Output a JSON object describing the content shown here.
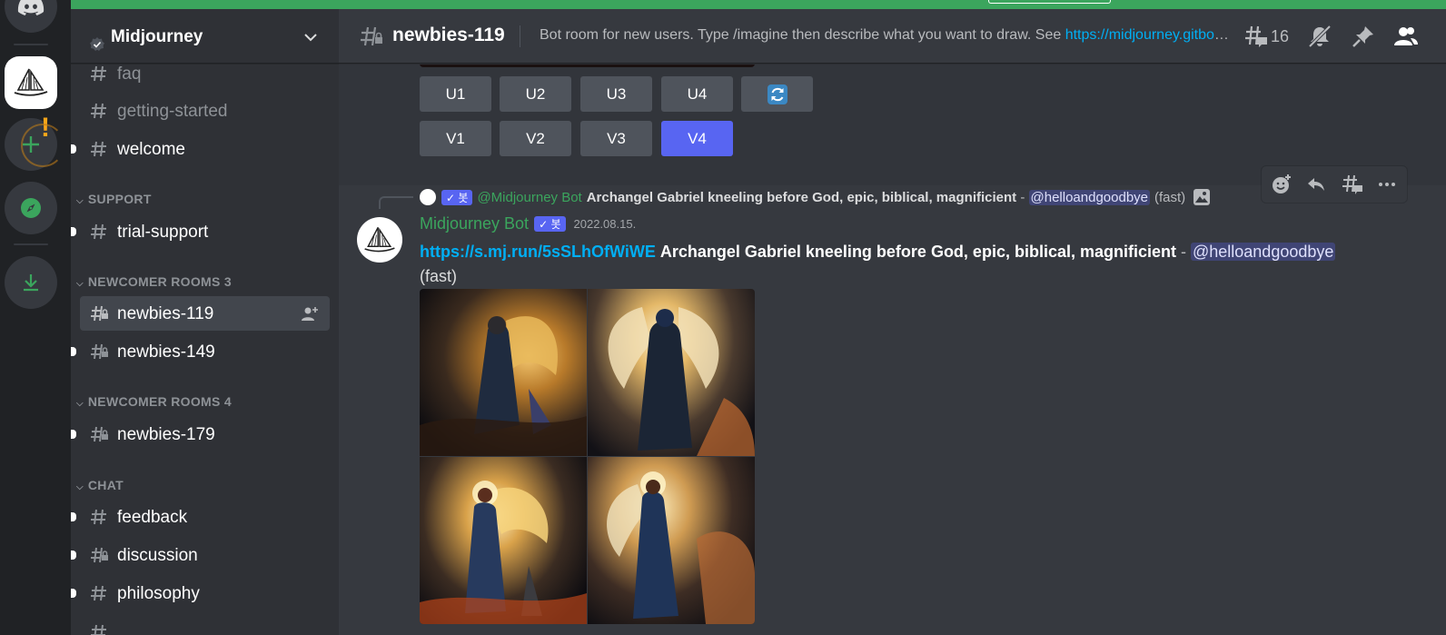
{
  "server": {
    "name": "Midjourney"
  },
  "sidebar": {
    "channels_top": [
      {
        "label": "faq"
      },
      {
        "label": "getting-started"
      },
      {
        "label": "welcome"
      }
    ],
    "categories": {
      "support": "SUPPORT",
      "newcomer3": "NEWCOMER ROOMS 3",
      "newcomer4": "NEWCOMER ROOMS 4",
      "chat": "CHAT"
    },
    "support_channels": [
      {
        "label": "trial-support"
      }
    ],
    "newcomer3_channels": [
      {
        "label": "newbies-119"
      },
      {
        "label": "newbies-149"
      }
    ],
    "newcomer4_channels": [
      {
        "label": "newbies-179"
      }
    ],
    "chat_channels": [
      {
        "label": "feedback"
      },
      {
        "label": "discussion"
      },
      {
        "label": "philosophy"
      }
    ]
  },
  "header": {
    "channel": "newbies-119",
    "topic_text": "Bot room for new users. Type /imagine then describe what you want to draw. See ",
    "topic_link": "https://midjourney.gitbook.io/docs/",
    "thread_count": "16"
  },
  "prev_message": {
    "buttons_u": [
      "U1",
      "U2",
      "U3",
      "U4"
    ],
    "buttons_v": [
      "V1",
      "V2",
      "V3",
      "V4"
    ]
  },
  "message": {
    "reply": {
      "author": "@Midjourney Bot",
      "prompt": "Archangel Gabriel kneeling before God, epic, biblical, magnificient",
      "sep": " - ",
      "mention": "@helloandgoodbye",
      "speed": "(fast)"
    },
    "author": "Midjourney Bot",
    "badge": "✓ 봇",
    "timestamp": "2022.08.15.",
    "link": "https://s.mj.run/5sSLhOfWiWE",
    "prompt": "Archangel Gabriel kneeling before God, epic, biblical, magnificient",
    "sep": " - ",
    "mention": "@helloandgoodbye",
    "speed": "(fast)"
  },
  "colors": {
    "accent": "#5865f2",
    "online_green": "#3ba55d",
    "link": "#00aff4"
  }
}
